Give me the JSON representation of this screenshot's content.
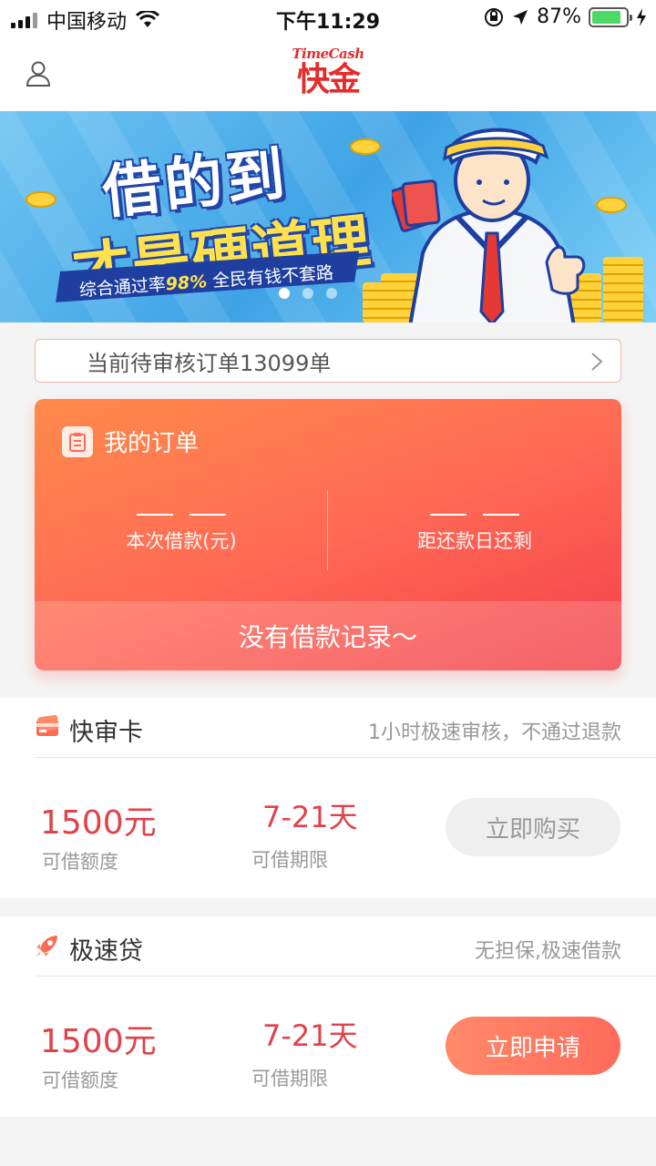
{
  "status_bar": {
    "carrier": "中国移动",
    "time": "下午11:29",
    "battery_percent": "87%",
    "battery_level": 0.87
  },
  "header": {
    "logo_small": "TimeCash",
    "logo_big": "快金"
  },
  "banner": {
    "line1": "借的到",
    "line2": "才是硬道理",
    "slogan_prefix": "综合通过率",
    "slogan_rate": "98%",
    "slogan_suffix": "全民有钱不套路",
    "active_dot": 0,
    "dot_count": 3
  },
  "notice": {
    "text": "当前待审核订单13099单"
  },
  "order": {
    "title": "我的订单",
    "loan_label": "本次借款(元)",
    "due_label": "距还款日还剩",
    "empty_text": "没有借款记录～"
  },
  "products": [
    {
      "name": "快审卡",
      "desc": "1小时极速审核，不通过退款",
      "amount": "1500元",
      "amount_label": "可借额度",
      "term": "7-21天",
      "term_label": "可借期限",
      "button": "立即购买"
    },
    {
      "name": "极速贷",
      "desc": "无担保,极速借款",
      "amount": "1500元",
      "amount_label": "可借额度",
      "term": "7-21天",
      "term_label": "可借期限",
      "button": "立即申请"
    }
  ],
  "colors": {
    "brand_red": "#e32d2d",
    "accent_orange": "#ff6a55",
    "price_red": "#e0424a"
  }
}
